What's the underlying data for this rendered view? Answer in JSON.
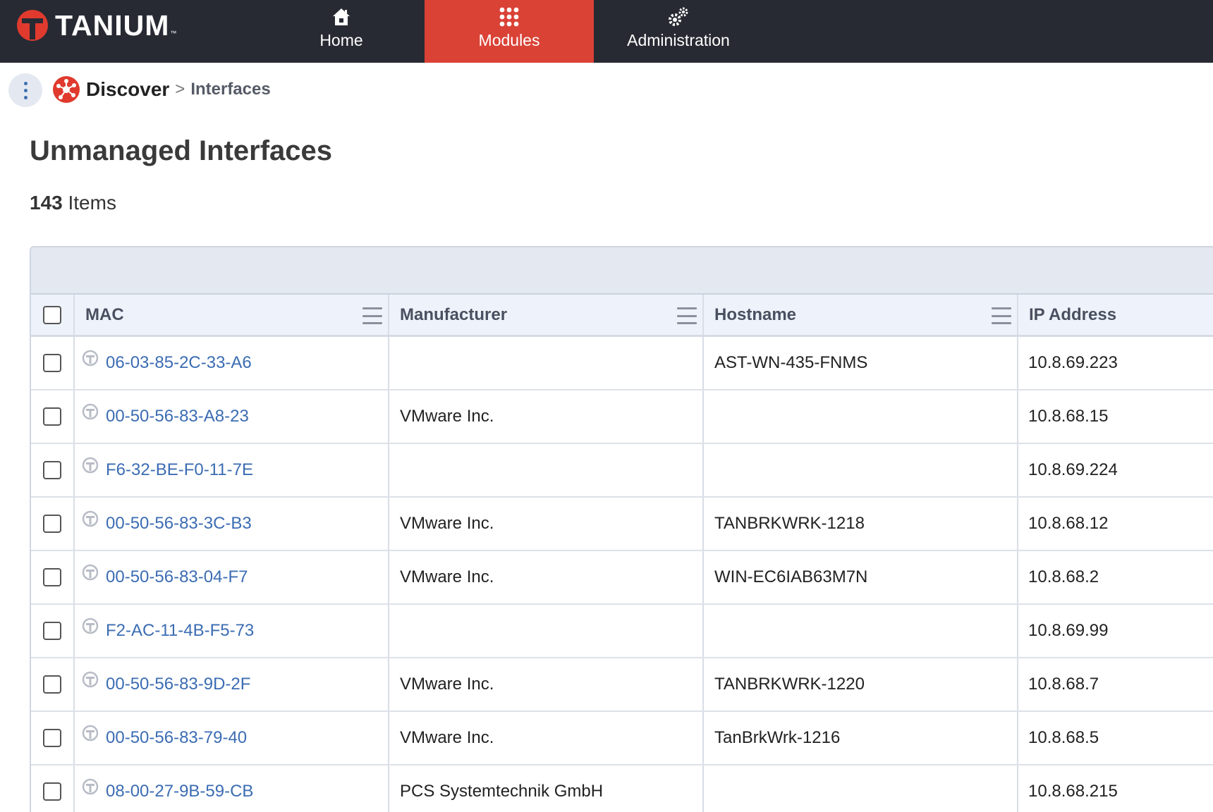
{
  "app": {
    "brand": "TANIUM",
    "brand_tm": "™"
  },
  "nav": {
    "home": "Home",
    "modules": "Modules",
    "administration": "Administration",
    "active_color": "#da4236"
  },
  "breadcrumb": {
    "module": "Discover",
    "separator": ">",
    "page": "Interfaces"
  },
  "page": {
    "title": "Unmanaged Interfaces",
    "count": "143",
    "count_label": "Items"
  },
  "table": {
    "columns": [
      "MAC",
      "Manufacturer",
      "Hostname",
      "IP Address"
    ],
    "rows": [
      {
        "mac": "06-03-85-2C-33-A6",
        "manufacturer": "",
        "hostname": "AST-WN-435-FNMS",
        "ip": "10.8.69.223"
      },
      {
        "mac": "00-50-56-83-A8-23",
        "manufacturer": "VMware Inc.",
        "hostname": "",
        "ip": "10.8.68.15"
      },
      {
        "mac": "F6-32-BE-F0-11-7E",
        "manufacturer": "",
        "hostname": "",
        "ip": "10.8.69.224"
      },
      {
        "mac": "00-50-56-83-3C-B3",
        "manufacturer": "VMware Inc.",
        "hostname": "TANBRKWRK-1218",
        "ip": "10.8.68.12"
      },
      {
        "mac": "00-50-56-83-04-F7",
        "manufacturer": "VMware Inc.",
        "hostname": "WIN-EC6IAB63M7N",
        "ip": "10.8.68.2"
      },
      {
        "mac": "F2-AC-11-4B-F5-73",
        "manufacturer": "",
        "hostname": "",
        "ip": "10.8.69.99"
      },
      {
        "mac": "00-50-56-83-9D-2F",
        "manufacturer": "VMware Inc.",
        "hostname": "TANBRKWRK-1220",
        "ip": "10.8.68.7"
      },
      {
        "mac": "00-50-56-83-79-40",
        "manufacturer": "VMware Inc.",
        "hostname": "TanBrkWrk-1216",
        "ip": "10.8.68.5"
      },
      {
        "mac": "08-00-27-9B-59-CB",
        "manufacturer": "PCS Systemtechnik GmbH",
        "hostname": "",
        "ip": "10.8.68.215"
      }
    ]
  },
  "icons": {
    "logo": "tanium-logo-icon",
    "home": "home-icon",
    "modules": "grid-dots-icon",
    "administration": "gears-icon",
    "menu": "vertical-dots-icon",
    "discover": "discover-network-icon",
    "mac_row": "tanium-endpoint-icon",
    "column_menu": "hamburger-icon"
  }
}
